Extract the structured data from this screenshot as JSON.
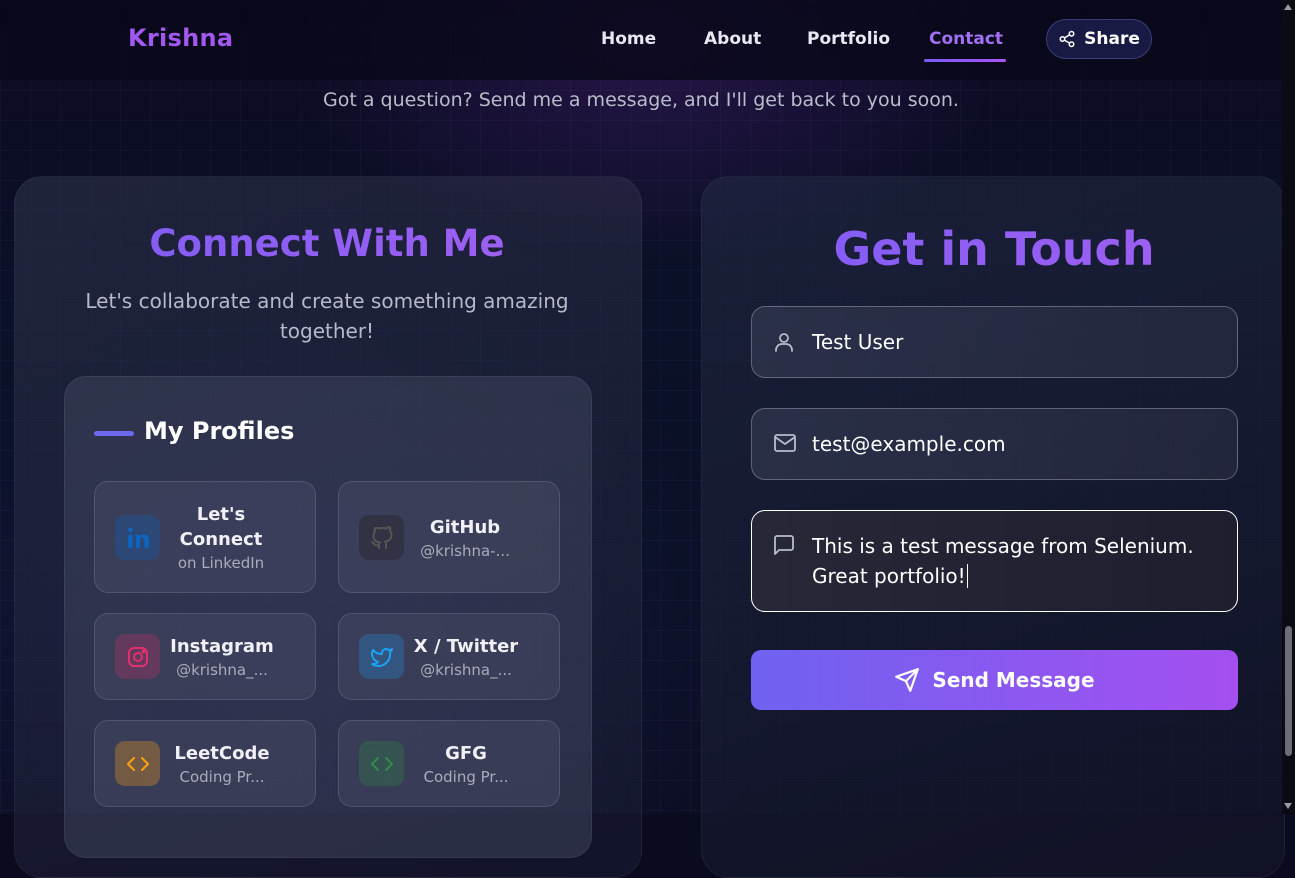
{
  "nav": {
    "brand": "Krishna",
    "links": [
      "Home",
      "About",
      "Portfolio",
      "Contact"
    ],
    "active": "Contact",
    "share_label": "Share"
  },
  "subtitle": "Got a question? Send me a message, and I'll get back to you soon.",
  "connect": {
    "title": "Connect With Me",
    "tagline_line1": "Let's collaborate and create something amazing",
    "tagline_line2": "together!",
    "profiles_title": "My Profiles",
    "profiles": [
      {
        "icon": "linkedin-icon",
        "name_line1": "Let's",
        "name_line2": "Connect",
        "sub": "on LinkedIn",
        "color": "#0a66c2"
      },
      {
        "icon": "github-icon",
        "name": "GitHub",
        "sub": "@krishna-...",
        "color": "#333333"
      },
      {
        "icon": "instagram-icon",
        "name": "Instagram",
        "sub": "@krishna_...",
        "color": "#e1306c"
      },
      {
        "icon": "twitter-icon",
        "name": "X / Twitter",
        "sub": "@krishna_...",
        "color": "#1da1f2"
      },
      {
        "icon": "leetcode-icon",
        "name": "LeetCode",
        "sub": "Coding Pr...",
        "color": "#ffa116"
      },
      {
        "icon": "gfg-icon",
        "name": "GFG",
        "sub": "Coding Pr...",
        "color": "#2f8d46"
      }
    ]
  },
  "form": {
    "title": "Get in Touch",
    "name_value": "Test User",
    "email_value": "test@example.com",
    "message_line1": "This is a test message from Selenium.",
    "message_line2": "Great portfolio!",
    "send_label": "Send Message"
  },
  "colors": {
    "accent": "#a257ef",
    "gradient_start": "#6f62f0",
    "gradient_end": "#a44ff0"
  }
}
